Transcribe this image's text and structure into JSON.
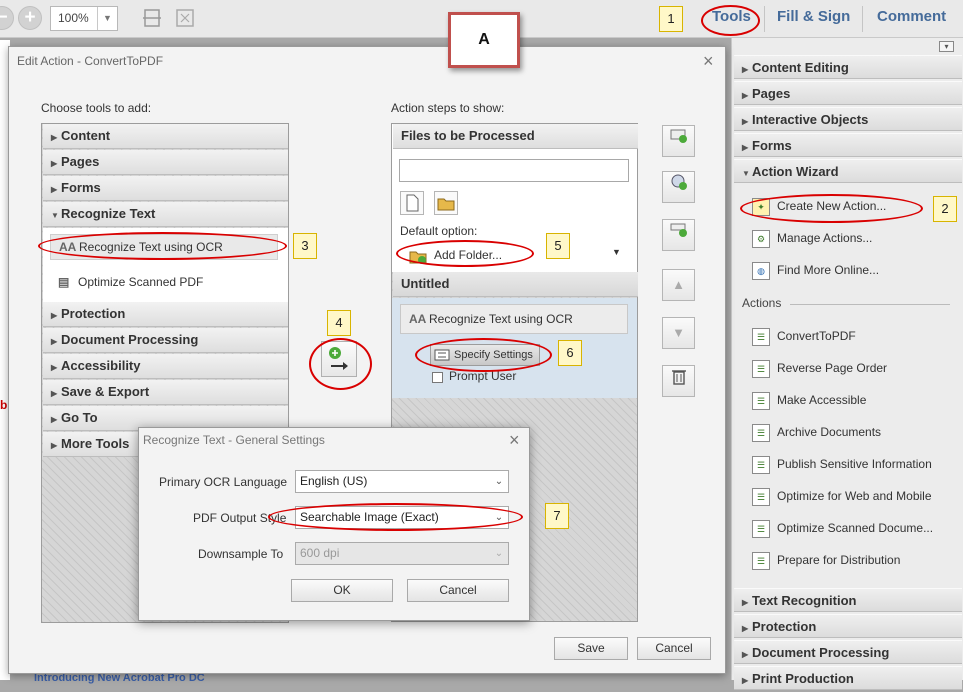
{
  "toolbar": {
    "zoom": "100%",
    "tabs": [
      "Tools",
      "Fill & Sign",
      "Comment"
    ]
  },
  "callouts": {
    "n1": "1",
    "n2": "2",
    "n3": "3",
    "n4": "4",
    "n5": "5",
    "n6": "6",
    "n7": "7",
    "a": "A"
  },
  "right_panel": {
    "sections_top": [
      "Content Editing",
      "Pages",
      "Interactive Objects",
      "Forms"
    ],
    "wizard": "Action Wizard",
    "wizard_items": [
      "Create New Action...",
      "Manage Actions...",
      "Find More Online..."
    ],
    "actions_heading": "Actions",
    "actions": [
      "ConvertToPDF",
      "Reverse Page Order",
      "Make Accessible",
      "Archive Documents",
      "Publish Sensitive Information",
      "Optimize for Web and Mobile",
      "Optimize Scanned Docume...",
      "Prepare for Distribution"
    ],
    "sections_bottom": [
      "Text Recognition",
      "Protection",
      "Document Processing",
      "Print Production"
    ]
  },
  "dialog": {
    "title": "Edit Action - ConvertToPDF",
    "choose_label": "Choose tools to add:",
    "tools_before": [
      "Content",
      "Pages",
      "Forms"
    ],
    "recognize_text": "Recognize Text",
    "recognize_items": [
      "Recognize Text using OCR",
      "Optimize Scanned PDF"
    ],
    "tools_after": [
      "Protection",
      "Document Processing",
      "Accessibility",
      "Save & Export",
      "Go To",
      "More Tools"
    ],
    "steps_label": "Action steps to show:",
    "files_header": "Files to be Processed",
    "files_input": "",
    "default_option_label": "Default option:",
    "add_folder": "Add Folder...",
    "untitled": "Untitled",
    "step_item": "Recognize Text using OCR",
    "specify": "Specify Settings",
    "prompt_user": "Prompt User",
    "save": "Save",
    "cancel": "Cancel"
  },
  "ocr_dialog": {
    "title": "Recognize Text - General Settings",
    "language_label": "Primary OCR Language",
    "language_value": "English (US)",
    "style_label": "PDF Output Style",
    "style_value": "Searchable Image (Exact)",
    "downsample_label": "Downsample To",
    "downsample_value": "600 dpi",
    "ok": "OK",
    "cancel": "Cancel"
  },
  "background_fragments": {
    "red_b": "b",
    "bottom_link": "Introducing New Acrobat Pro DC"
  }
}
